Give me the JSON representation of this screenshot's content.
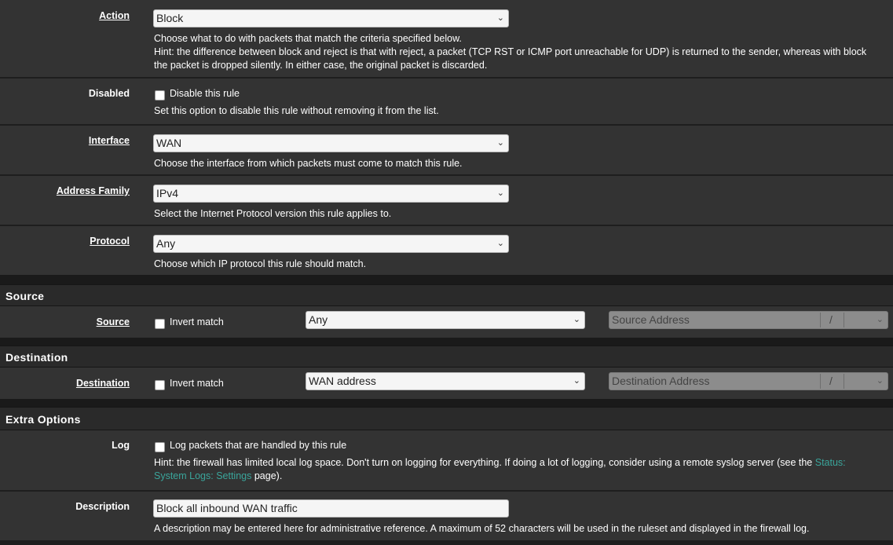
{
  "action": {
    "label": "Action",
    "value": "Block",
    "help1": "Choose what to do with packets that match the criteria specified below.",
    "help2": "Hint: the difference between block and reject is that with reject, a packet (TCP RST or ICMP port unreachable for UDP) is returned to the sender, whereas with block",
    "help3": "the packet is dropped silently. In either case, the original packet is discarded."
  },
  "disabled": {
    "label": "Disabled",
    "checkbox_label": "Disable this rule",
    "help": "Set this option to disable this rule without removing it from the list."
  },
  "interface": {
    "label": "Interface",
    "value": "WAN",
    "help": "Choose the interface from which packets must come to match this rule."
  },
  "address_family": {
    "label": "Address Family",
    "value": "IPv4",
    "help": "Select the Internet Protocol version this rule applies to."
  },
  "protocol": {
    "label": "Protocol",
    "value": "Any",
    "help": "Choose which IP protocol this rule should match."
  },
  "source_section": {
    "title": "Source",
    "label": "Source",
    "invert_label": "Invert match",
    "type_value": "Any",
    "address_placeholder": "Source Address",
    "slash": "/"
  },
  "destination_section": {
    "title": "Destination",
    "label": "Destination",
    "invert_label": "Invert match",
    "type_value": "WAN address",
    "address_placeholder": "Destination Address",
    "slash": "/"
  },
  "extra_section": {
    "title": "Extra Options"
  },
  "log": {
    "label": "Log",
    "checkbox_label": "Log packets that are handled by this rule",
    "help_prefix": "Hint: the firewall has limited local log space. Don't turn on logging for everything. If doing a lot of logging, consider using a remote syslog server (see the",
    "link1": "Status:",
    "link2": "System Logs: Settings",
    "help_suffix": " page)."
  },
  "description": {
    "label": "Description",
    "value": "Block all inbound WAN traffic",
    "help": "A description may be entered here for administrative reference. A maximum of 52 characters will be used in the ruleset and displayed in the firewall log."
  },
  "icons": {
    "chevron": "chevron-down-icon"
  }
}
